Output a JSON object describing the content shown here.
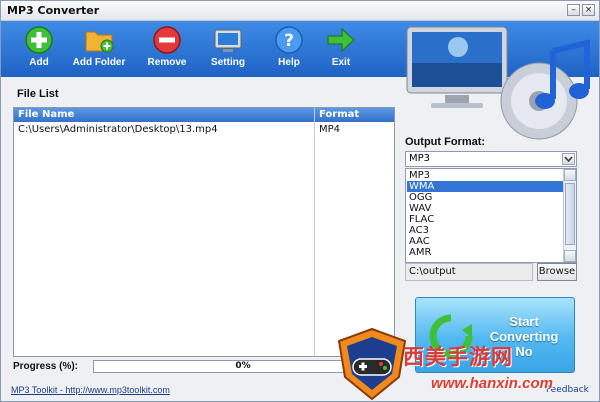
{
  "window": {
    "title": "MP3 Converter",
    "minimize": "–",
    "close": "×"
  },
  "toolbar": {
    "add": "Add",
    "add_folder": "Add Folder",
    "remove": "Remove",
    "setting": "Setting",
    "help": "Help",
    "exit": "Exit"
  },
  "file_list": {
    "title": "File List",
    "columns": [
      "File Name",
      "Format"
    ],
    "rows": [
      {
        "name": "C:\\Users\\Administrator\\Desktop\\13.mp4",
        "format": "MP4"
      }
    ]
  },
  "output": {
    "label": "Output Format:",
    "selected": "MP3",
    "options": [
      "MP3",
      "WMA",
      "OGG",
      "WAV",
      "FLAC",
      "AC3",
      "AAC",
      "AMR"
    ],
    "highlighted": "WMA",
    "path": "C:\\output",
    "browse": "Browse"
  },
  "start_button": {
    "line1": "Start",
    "line2": "Converting",
    "line3": "No"
  },
  "progress": {
    "label": "Progress (%):",
    "text": "0%",
    "value": 0
  },
  "footer": {
    "link": "MP3 Toolkit - http://www.mp3toolkit.com",
    "feedback": "Feedback"
  },
  "watermark": {
    "chars": "西美手游网",
    "url": "www.hanxin.com"
  },
  "colors": {
    "toolbar": "#2a72d4",
    "progress_fill": "#3aa040",
    "start": "#52b8f0"
  }
}
